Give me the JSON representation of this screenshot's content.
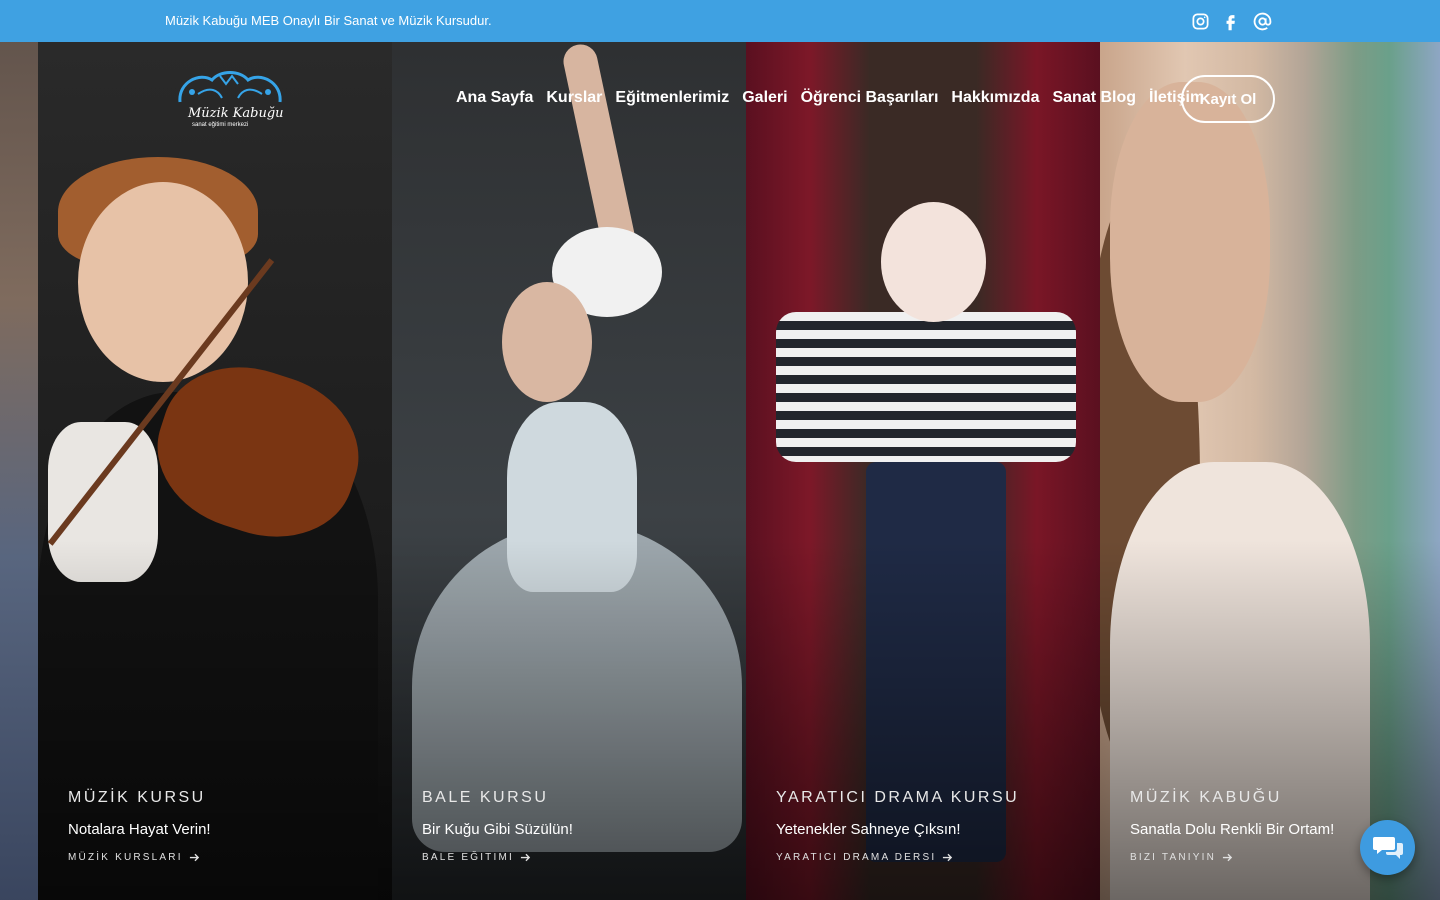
{
  "topbar": {
    "text": "Müzik Kabuğu MEB Onaylı Bir Sanat ve Müzik Kursudur.",
    "social": [
      {
        "name": "instagram-icon"
      },
      {
        "name": "facebook-icon"
      },
      {
        "name": "email-icon"
      }
    ]
  },
  "logo": {
    "line1": "Müzik Kabuğu",
    "line2": "sanat eğitimi merkezi"
  },
  "nav": {
    "items": [
      "Ana Sayfa",
      "Kurslar",
      "Eğitmenlerimiz",
      "Galeri",
      "Öğrenci Başarıları",
      "Hakkımızda",
      "Sanat Blog",
      "İletişim"
    ],
    "cta": "Kayıt Ol"
  },
  "panels": [
    {
      "kicker": "MÜZİK KURSU",
      "title": "Notalara Hayat Verin!",
      "link": "MÜZİK KURSLARI"
    },
    {
      "kicker": "BALE KURSU",
      "title": "Bir Kuğu Gibi Süzülün!",
      "link": "BALE EĞITIMI"
    },
    {
      "kicker": "YARATICI DRAMA KURSU",
      "title": "Yetenekler Sahneye Çıksın!",
      "link": "YARATICI DRAMA DERSI"
    },
    {
      "kicker": "MÜZİK KABUĞU",
      "title": "Sanatla Dolu Renkli Bir Ortam!",
      "link": "BIZI TANIYIN"
    }
  ],
  "colors": {
    "topbar": "#3fa1e2",
    "chat": "#3e9be0"
  }
}
